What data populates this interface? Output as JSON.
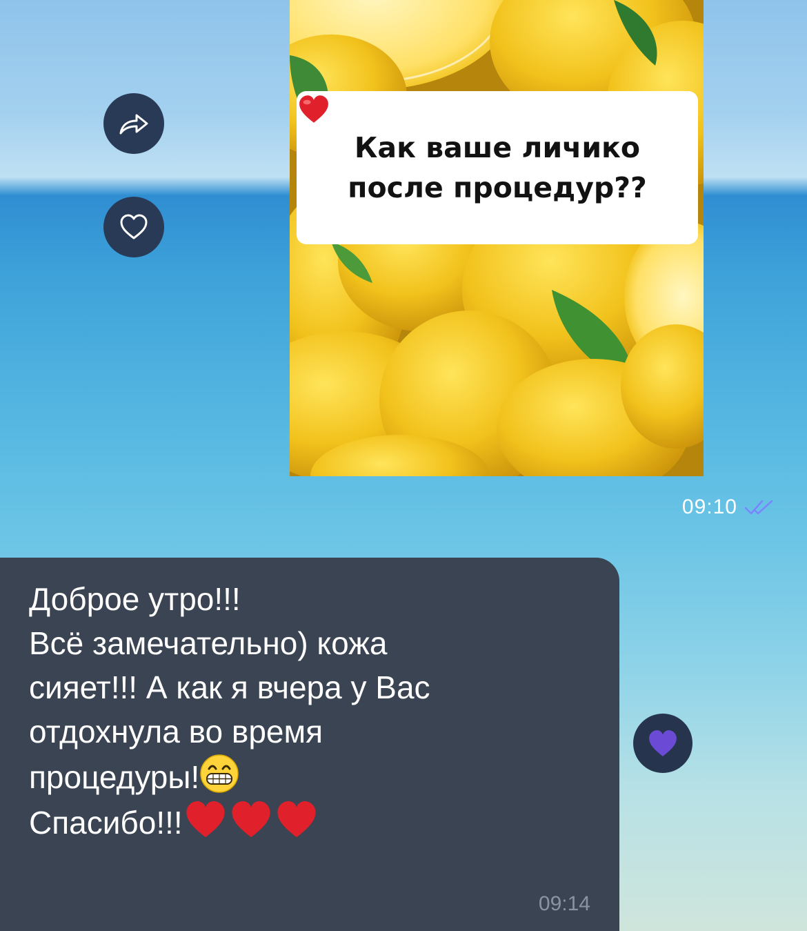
{
  "chat": {
    "outgoing": {
      "image_caption_lines": "Как ваше личико\nпосле процедур??",
      "caption_emoji": "heart-emoji",
      "time": "09:10",
      "status": "read-double-check"
    },
    "incoming": {
      "lines": [
        "Доброе утро!!!",
        "Всё замечательно) кожа",
        "сияет!!! А как я вчера у Вас",
        "отдохнула во время",
        "процедуры!",
        "Спасибо!!!"
      ],
      "emojis": [
        "grinning-face-emoji",
        "heart-emoji",
        "heart-emoji",
        "heart-emoji"
      ],
      "time": "09:14",
      "reaction": "purple-heart-emoji"
    },
    "side_actions": [
      "share-icon",
      "heart-outline-icon"
    ]
  },
  "colors": {
    "bubble_incoming": "#3b4453",
    "action_button": "#283a55",
    "read_ticks": "#7b84ff",
    "reaction_heart": "#6b4bd6",
    "heart_red": "#e0202a"
  }
}
